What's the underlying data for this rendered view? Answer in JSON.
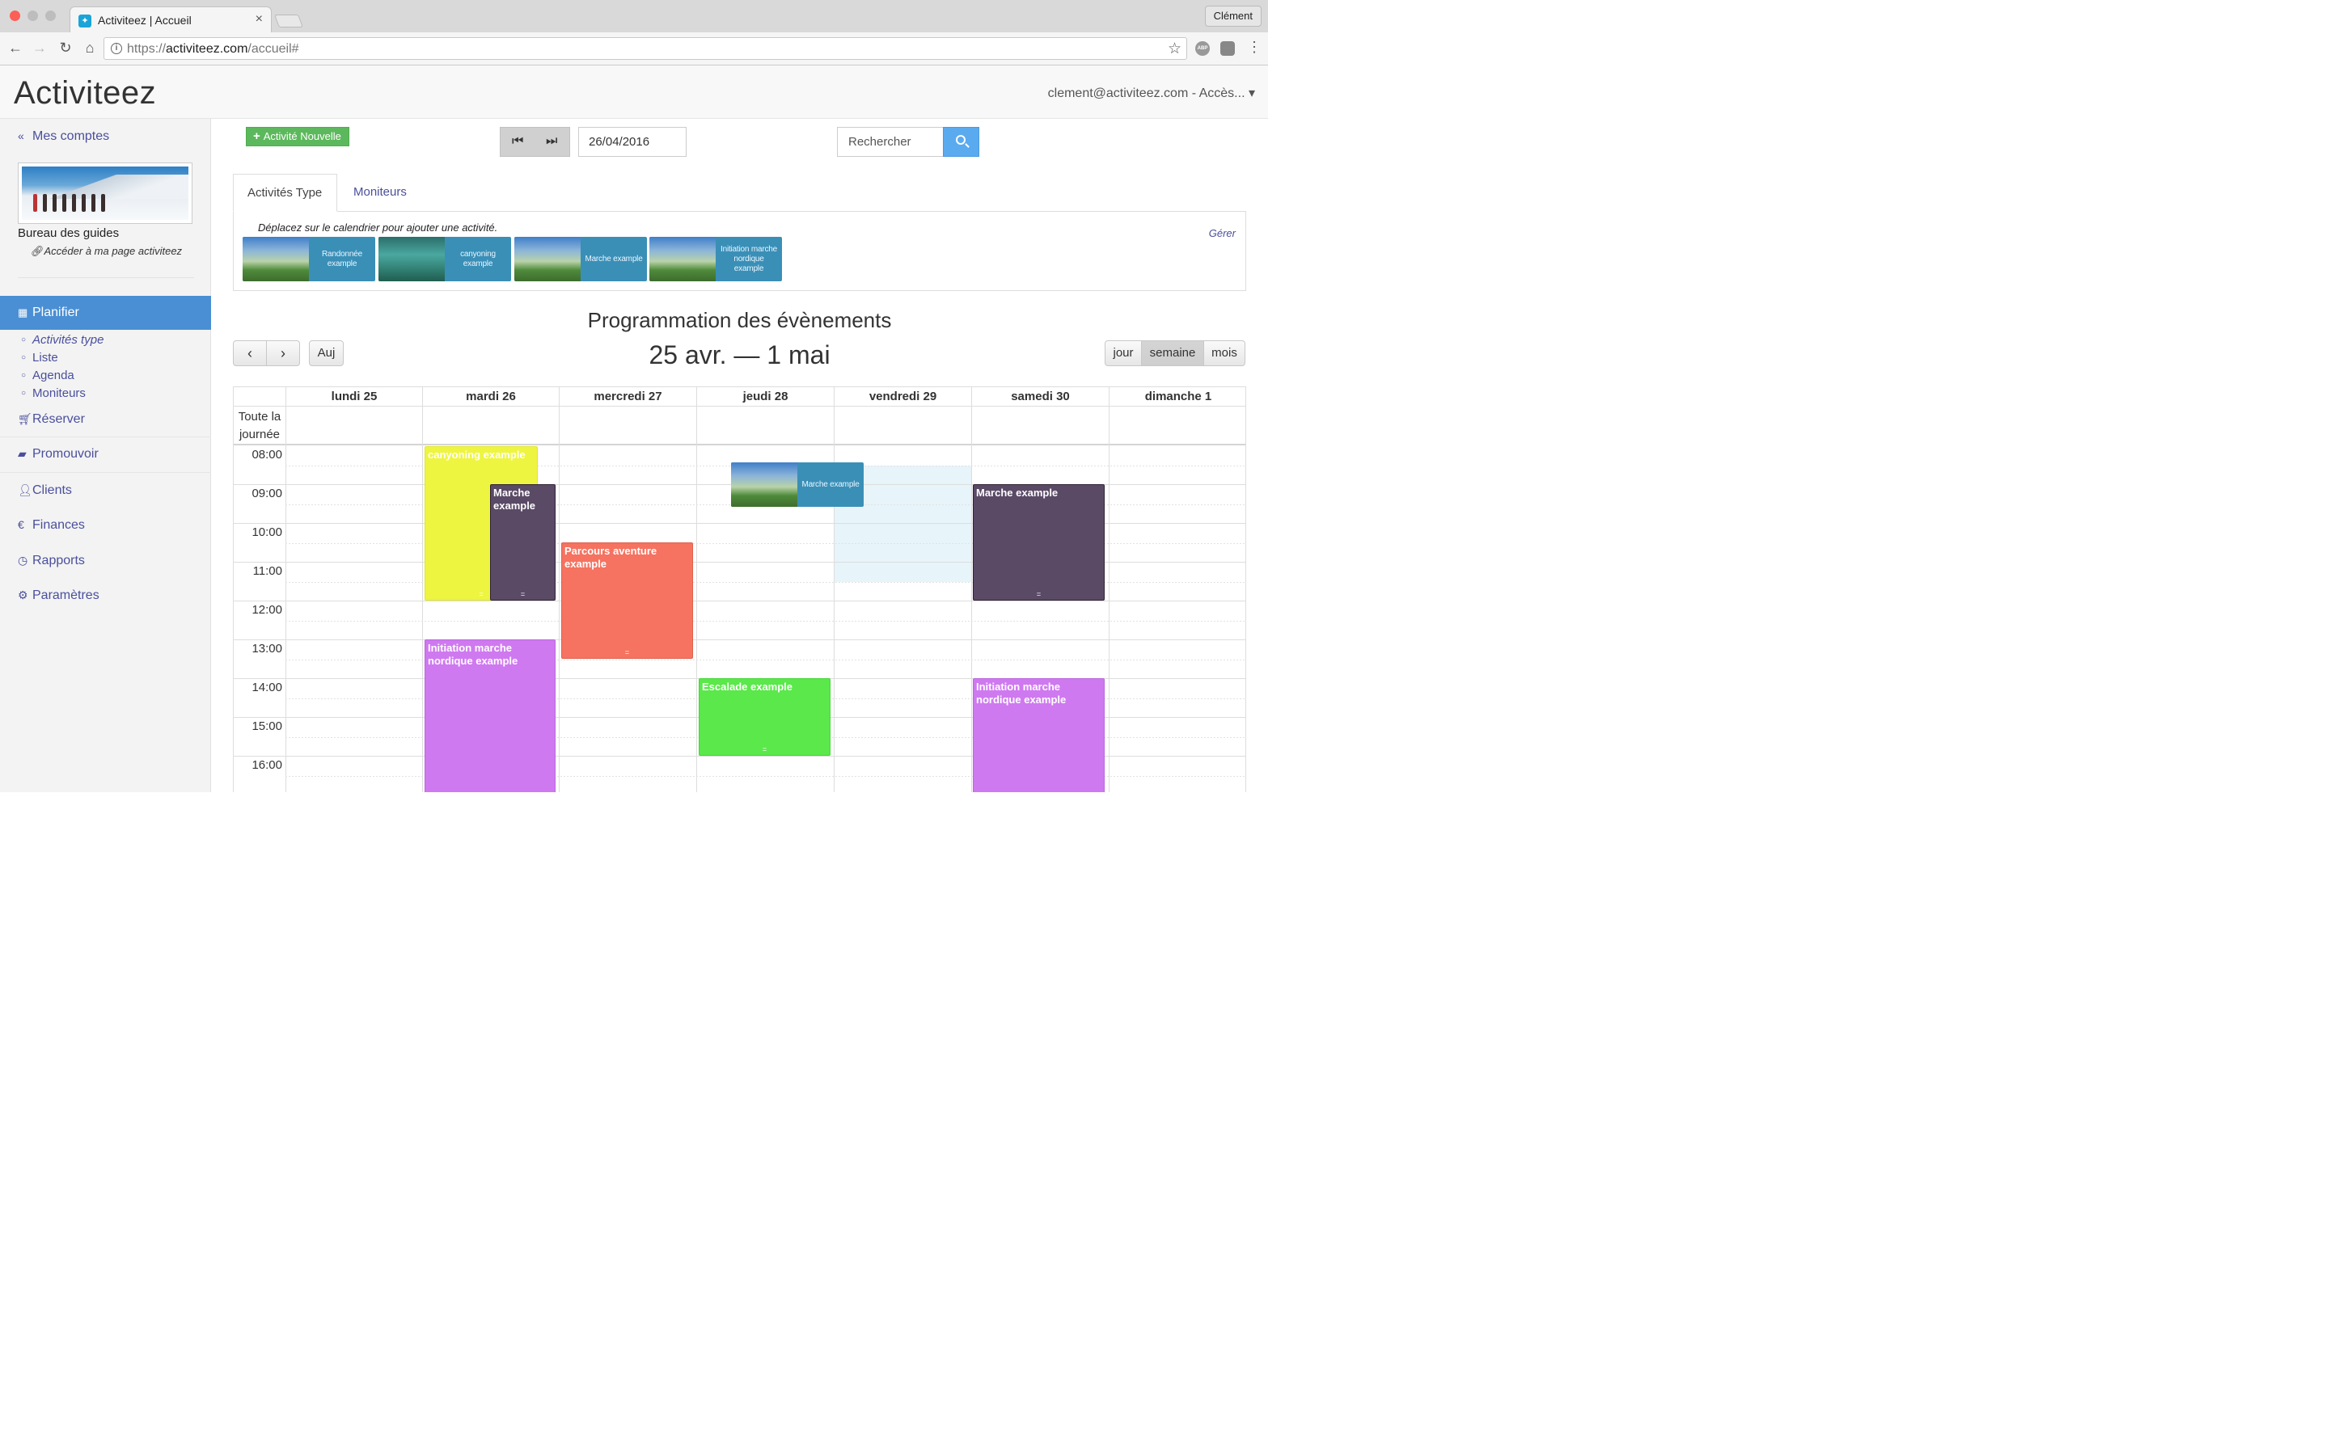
{
  "browser": {
    "tab_title": "Activiteez | Accueil",
    "tab_close": "×",
    "profile": "Clément",
    "url_prefix": "https://",
    "url_domain": "activiteez.com",
    "url_path": "/accueil#"
  },
  "header": {
    "brand": "Activiteez",
    "user_menu": "clement@activiteez.com - Accès... ▾"
  },
  "sidebar": {
    "mes_comptes": "Mes comptes",
    "account_name": "Bureau des guides",
    "account_page": "Accéder à ma page activiteez",
    "planifier": "Planifier",
    "planifier_sub": [
      "Activités type",
      "Liste",
      "Agenda",
      "Moniteurs"
    ],
    "items": [
      "Réserver",
      "Promouvoir",
      "Clients",
      "Finances",
      "Rapports",
      "Paramètres"
    ]
  },
  "controls": {
    "new_activity": "Activité Nouvelle",
    "date_value": "26/04/2016",
    "search_placeholder": "Rechercher"
  },
  "tabs": {
    "activity_types": "Activités Type",
    "instructors": "Moniteurs",
    "hint": "Déplacez sur le calendrier pour ajouter une activité.",
    "manage": "Gérer",
    "types": [
      "Randonnée example",
      "canyoning example",
      "Marche example",
      "Initiation marche nordique example"
    ]
  },
  "calendar": {
    "title": "Programmation des évènements",
    "range": "25 avr. — 1 mai",
    "today": "Auj",
    "views": {
      "day": "jour",
      "week": "semaine",
      "month": "mois"
    },
    "days": [
      "lundi 25",
      "mardi 26",
      "mercredi 27",
      "jeudi 28",
      "vendredi 29",
      "samedi 30",
      "dimanche 1"
    ],
    "allday": "Toute la journée",
    "hours": [
      "08:00",
      "09:00",
      "10:00",
      "11:00",
      "12:00",
      "13:00",
      "14:00",
      "15:00",
      "16:00"
    ],
    "events": [
      {
        "title": "canyoning example",
        "day": "mardi 26",
        "start": "08:00",
        "end": "12:00",
        "color": "#eef540"
      },
      {
        "title": "Marche example",
        "day": "mardi 26",
        "start": "09:00",
        "end": "12:00",
        "color": "#5a4a66"
      },
      {
        "title": "Parcours aventure example",
        "day": "mercredi 27",
        "start": "10:30",
        "end": "13:30",
        "color": "#f57360"
      },
      {
        "title": "Initiation marche nordique example",
        "day": "mardi 26",
        "start": "13:00",
        "end": "17:00",
        "color": "#cf79f0"
      },
      {
        "title": "Escalade example",
        "day": "jeudi 28",
        "start": "14:00",
        "end": "16:00",
        "color": "#5ae84a"
      },
      {
        "title": "Marche example",
        "day": "samedi 30",
        "start": "09:00",
        "end": "12:00",
        "color": "#5a4a66"
      },
      {
        "title": "Initiation marche nordique example",
        "day": "samedi 30",
        "start": "14:00",
        "end": "17:00",
        "color": "#cf79f0"
      }
    ],
    "dragging": "Marche example",
    "grip": "="
  }
}
